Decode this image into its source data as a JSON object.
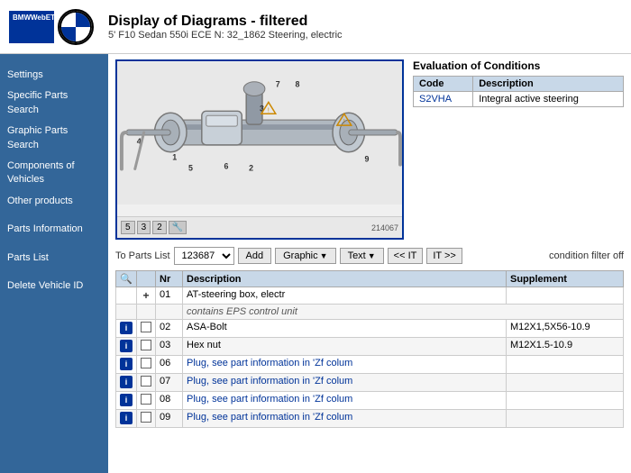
{
  "header": {
    "title": "Display of Diagrams - filtered",
    "subtitle": "5' F10 Sedan 550i ECE N: 32_1862 Steering, electric",
    "logo_etk": "BMWWebETK",
    "logo_alt": "BMW"
  },
  "sidebar": {
    "items": [
      {
        "id": "settings",
        "label": "Settings"
      },
      {
        "id": "specific-parts",
        "label": "Specific Parts Search"
      },
      {
        "id": "graphic-parts",
        "label": "Graphic Parts Search"
      },
      {
        "id": "components",
        "label": "Components of Vehicles"
      },
      {
        "id": "other-products",
        "label": "Other products"
      },
      {
        "id": "parts-info",
        "label": "Parts Information"
      },
      {
        "id": "parts-list",
        "label": "Parts List"
      },
      {
        "id": "delete-vehicle",
        "label": "Delete Vehicle ID"
      }
    ]
  },
  "evaluation": {
    "title": "Evaluation of Conditions",
    "table_headers": [
      "Code",
      "Description"
    ],
    "rows": [
      {
        "code": "S2VHA",
        "description": "Integral active steering"
      }
    ]
  },
  "parts_toolbar": {
    "label": "To Parts List",
    "select_value": "123687",
    "add_label": "Add",
    "graphic_label": "Graphic",
    "text_label": "Text",
    "nav_prev": "<< IT",
    "nav_next": "IT >>",
    "filter_label": "condition filter off"
  },
  "parts_table": {
    "headers": [
      "",
      "",
      "Nr",
      "Description",
      "Supplement"
    ],
    "rows": [
      {
        "type": "main",
        "icon": "",
        "check": "+",
        "nr": "01",
        "description": "AT-steering box, electr",
        "supplement": ""
      },
      {
        "type": "sub",
        "nr": "",
        "description": "contains EPS control unit",
        "supplement": ""
      },
      {
        "type": "data",
        "icon": "i",
        "check": true,
        "nr": "02",
        "description": "ASA-Bolt",
        "supplement": "M12X1,5X56-10.9"
      },
      {
        "type": "data",
        "icon": "i",
        "check": true,
        "nr": "03",
        "description": "Hex nut",
        "supplement": "M12X1.5-10.9"
      },
      {
        "type": "data",
        "icon": "i",
        "check": true,
        "nr": "06",
        "description_link": "Plug, see part information in 'Zf colum",
        "supplement": ""
      },
      {
        "type": "data",
        "icon": "i",
        "check": true,
        "nr": "07",
        "description_link": "Plug, see part information in 'Zf colum",
        "supplement": ""
      },
      {
        "type": "data",
        "icon": "i",
        "check": true,
        "nr": "08",
        "description_link": "Plug, see part information in 'Zf colum",
        "supplement": ""
      },
      {
        "type": "data",
        "icon": "i",
        "check": true,
        "nr": "09",
        "description_link": "Plug, see part information in 'Zf colum",
        "supplement": ""
      }
    ]
  },
  "diagram_toolbar": {
    "btn1": "5",
    "btn2": "3",
    "btn3": "2",
    "tool_icon": "🔧"
  }
}
